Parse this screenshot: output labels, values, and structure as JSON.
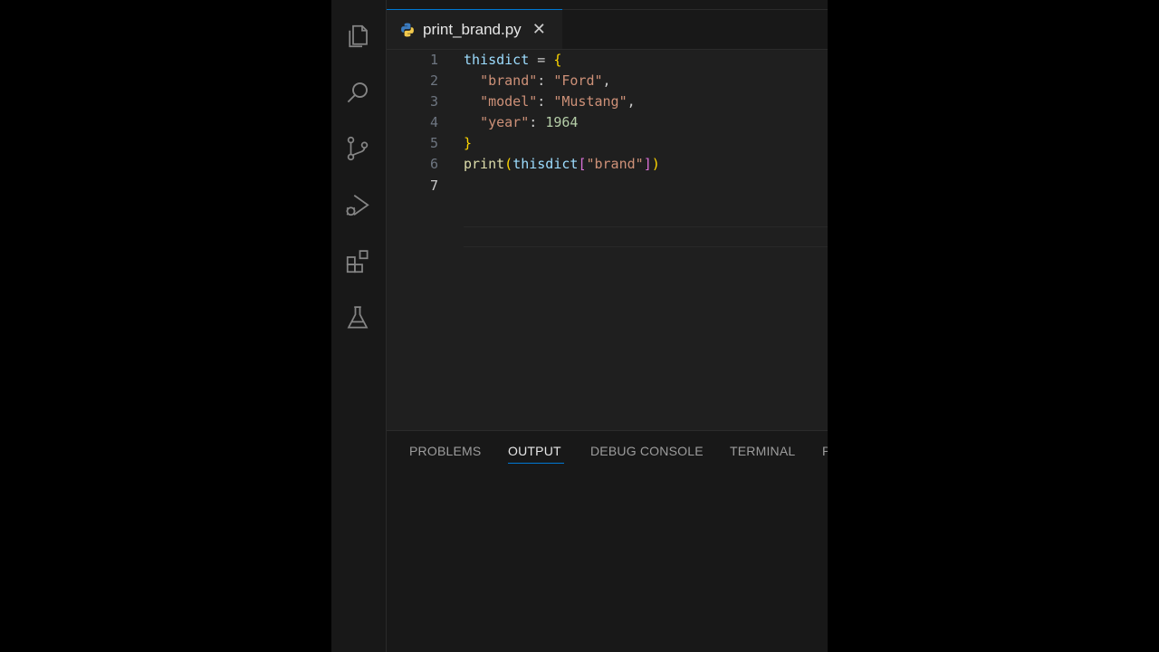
{
  "tabs": [
    {
      "label": "print_brand.py",
      "icon": "python-icon"
    }
  ],
  "editor": {
    "active_line": 7,
    "lines": [
      {
        "number": "1",
        "tokens": [
          "thisdict",
          " = ",
          "{"
        ]
      },
      {
        "number": "2",
        "tokens": [
          "  ",
          "\"brand\"",
          ": ",
          "\"Ford\"",
          ","
        ]
      },
      {
        "number": "3",
        "tokens": [
          "  ",
          "\"model\"",
          ": ",
          "\"Mustang\"",
          ","
        ]
      },
      {
        "number": "4",
        "tokens": [
          "  ",
          "\"year\"",
          ": ",
          "1964"
        ]
      },
      {
        "number": "5",
        "tokens": [
          "}"
        ]
      },
      {
        "number": "6",
        "tokens": [
          "print",
          "(",
          "thisdict",
          "[",
          "\"brand\"",
          "]",
          ")"
        ]
      },
      {
        "number": "7",
        "tokens": []
      }
    ]
  },
  "panel": {
    "tabs": [
      "PROBLEMS",
      "OUTPUT",
      "DEBUG CONSOLE",
      "TERMINAL",
      "P"
    ],
    "active_tab": "OUTPUT"
  },
  "activity_bar": [
    "files-icon",
    "search-icon",
    "source-control-icon",
    "run-debug-icon",
    "extensions-icon",
    "testing-icon"
  ],
  "colors": {
    "accent": "#0078d4",
    "editor_bg": "#1f1f1f",
    "sidebar_bg": "#181818"
  }
}
